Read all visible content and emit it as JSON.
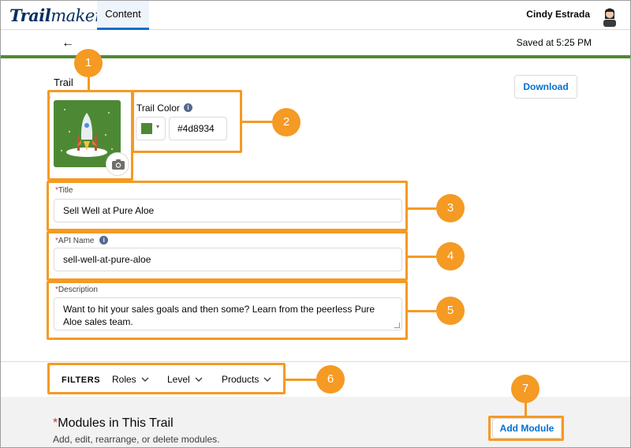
{
  "header": {
    "logo_bold": "Trail",
    "logo_rest": "maker",
    "tab_label": "Content",
    "user_name": "Cindy Estrada"
  },
  "subheader": {
    "back_icon": "←",
    "saved_text": "Saved at 5:25 PM"
  },
  "trail": {
    "section_label": "Trail",
    "required_marker": "*",
    "download_label": "Download",
    "color_label": "Trail Color",
    "color_info_icon": "i",
    "color_value": "#4d8934",
    "swatch_caret": "▾"
  },
  "fields": {
    "title": {
      "required": "*",
      "label": "Title",
      "value": "Sell Well at Pure Aloe"
    },
    "api_name": {
      "required": "*",
      "label": "API Name",
      "info_icon": "i",
      "value": "sell-well-at-pure-aloe"
    },
    "description": {
      "required": "*",
      "label": "Description",
      "value": "Want to hit your sales goals and then some? Learn from the peerless Pure Aloe sales team."
    }
  },
  "filters": {
    "title": "FILTERS",
    "items": [
      {
        "label": "Roles"
      },
      {
        "label": "Level"
      },
      {
        "label": "Products"
      }
    ]
  },
  "modules": {
    "required": "*",
    "title": "Modules in This Trail",
    "subtitle": "Add, edit, rearrange, or delete modules.",
    "add_label": "Add Module"
  },
  "callouts": [
    "1",
    "2",
    "3",
    "4",
    "5",
    "6",
    "7"
  ],
  "colors": {
    "accent": "#f59a23",
    "trail_green": "#4d8934",
    "link_blue": "#0070d2"
  }
}
